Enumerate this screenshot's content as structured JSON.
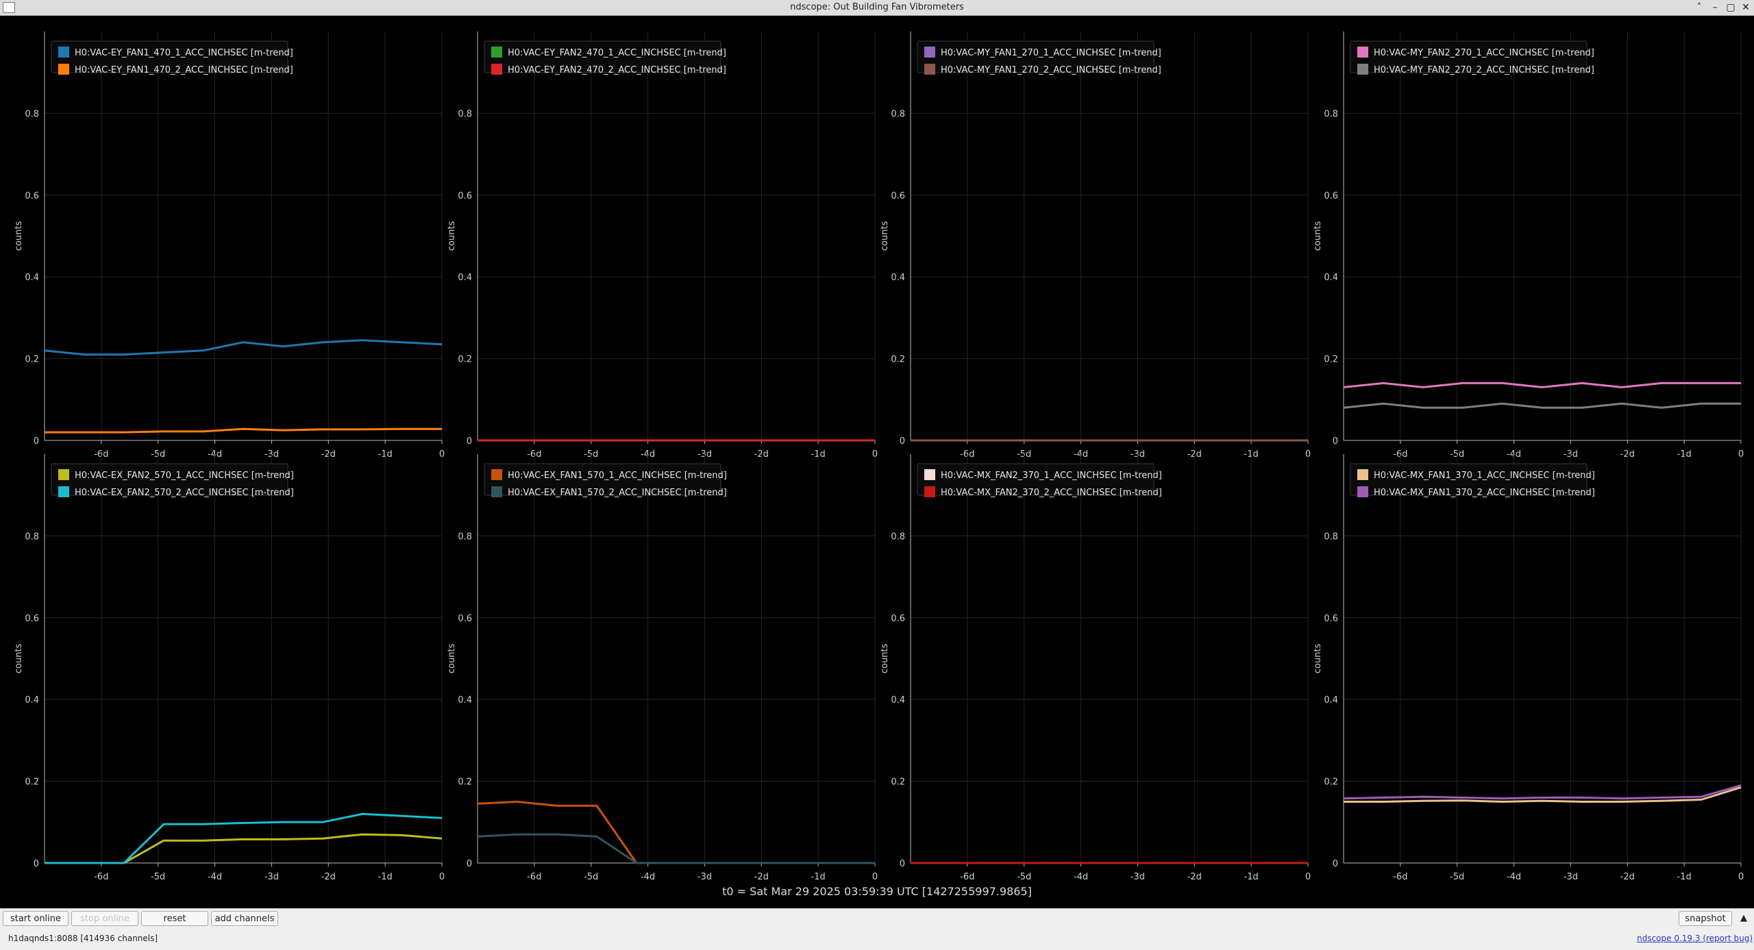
{
  "window": {
    "title": "ndscope: Out Building Fan Vibrometers",
    "buttons": [
      "˄",
      "–",
      "▢",
      "✕"
    ]
  },
  "axes": {
    "ylabel": "counts",
    "yticks": [
      "0",
      "0.2",
      "0.4",
      "0.6",
      "0.8"
    ],
    "xticks": [
      "-6d",
      "-5d",
      "-4d",
      "-3d",
      "-2d",
      "-1d",
      "0"
    ]
  },
  "chart_data": [
    {
      "type": "line",
      "series": [
        {
          "name": "H0:VAC-EY_FAN1_470_1_ACC_INCHSEC [m-trend]",
          "color": "#1f77b4",
          "y": [
            0.22,
            0.21,
            0.21,
            0.215,
            0.22,
            0.24,
            0.23,
            0.24,
            0.245,
            0.24,
            0.235
          ]
        },
        {
          "name": "H0:VAC-EY_FAN1_470_2_ACC_INCHSEC [m-trend]",
          "color": "#ff7f0e",
          "y": [
            0.02,
            0.02,
            0.02,
            0.022,
            0.022,
            0.028,
            0.025,
            0.027,
            0.027,
            0.028,
            0.028
          ]
        }
      ],
      "xlim": [
        -7,
        0
      ],
      "ylim": [
        0,
        1
      ],
      "xlabel": "",
      "ylabel": "counts",
      "grid": true,
      "legend": "top-left"
    },
    {
      "type": "line",
      "series": [
        {
          "name": "H0:VAC-EY_FAN2_470_1_ACC_INCHSEC [m-trend]",
          "color": "#2ca02c",
          "y": [
            0,
            0,
            0,
            0,
            0,
            0,
            0,
            0,
            0,
            0,
            0
          ]
        },
        {
          "name": "H0:VAC-EY_FAN2_470_2_ACC_INCHSEC [m-trend]",
          "color": "#d62728",
          "y": [
            0,
            0,
            0,
            0,
            0,
            0,
            0,
            0,
            0,
            0,
            0
          ]
        }
      ],
      "xlim": [
        -7,
        0
      ],
      "ylim": [
        0,
        1
      ],
      "xlabel": "",
      "ylabel": "counts",
      "grid": true,
      "legend": "top-left"
    },
    {
      "type": "line",
      "series": [
        {
          "name": "H0:VAC-MY_FAN1_270_1_ACC_INCHSEC [m-trend]",
          "color": "#9467bd",
          "y": [
            0,
            0,
            0,
            0,
            0,
            0,
            0,
            0,
            0,
            0,
            0
          ]
        },
        {
          "name": "H0:VAC-MY_FAN1_270_2_ACC_INCHSEC [m-trend]",
          "color": "#8c564b",
          "y": [
            0,
            0,
            0,
            0,
            0,
            0,
            0,
            0,
            0,
            0,
            0
          ]
        }
      ],
      "xlim": [
        -7,
        0
      ],
      "ylim": [
        0,
        1
      ],
      "xlabel": "",
      "ylabel": "counts",
      "grid": true,
      "legend": "top-left"
    },
    {
      "type": "line",
      "series": [
        {
          "name": "H0:VAC-MY_FAN2_270_1_ACC_INCHSEC [m-trend]",
          "color": "#e377c2",
          "y": [
            0.13,
            0.14,
            0.13,
            0.14,
            0.14,
            0.13,
            0.14,
            0.13,
            0.14,
            0.14,
            0.14
          ]
        },
        {
          "name": "H0:VAC-MY_FAN2_270_2_ACC_INCHSEC [m-trend]",
          "color": "#7f7f7f",
          "y": [
            0.08,
            0.09,
            0.08,
            0.08,
            0.09,
            0.08,
            0.08,
            0.09,
            0.08,
            0.09,
            0.09
          ]
        }
      ],
      "xlim": [
        -7,
        0
      ],
      "ylim": [
        0,
        1
      ],
      "xlabel": "",
      "ylabel": "counts",
      "grid": true,
      "legend": "top-left"
    },
    {
      "type": "line",
      "series": [
        {
          "name": "H0:VAC-EX_FAN2_570_1_ACC_INCHSEC [m-trend]",
          "color": "#bcbd22",
          "y": [
            0,
            0,
            0,
            0.055,
            0.055,
            0.058,
            0.058,
            0.06,
            0.07,
            0.068,
            0.06
          ]
        },
        {
          "name": "H0:VAC-EX_FAN2_570_2_ACC_INCHSEC [m-trend]",
          "color": "#17becf",
          "y": [
            0,
            0,
            0,
            0.095,
            0.095,
            0.098,
            0.1,
            0.1,
            0.12,
            0.115,
            0.11
          ]
        }
      ],
      "xlim": [
        -7,
        0
      ],
      "ylim": [
        0,
        1
      ],
      "xlabel": "",
      "ylabel": "counts",
      "grid": true,
      "legend": "top-left"
    },
    {
      "type": "line",
      "series": [
        {
          "name": "H0:VAC-EX_FAN1_570_1_ACC_INCHSEC [m-trend]",
          "color": "#c8510e",
          "y": [
            0.145,
            0.15,
            0.14,
            0.14,
            0,
            0,
            0,
            0,
            0,
            0,
            0
          ]
        },
        {
          "name": "H0:VAC-EX_FAN1_570_2_ACC_INCHSEC [m-trend]",
          "color": "#2f5560",
          "y": [
            0.065,
            0.07,
            0.07,
            0.065,
            0,
            0,
            0,
            0,
            0,
            0,
            0
          ]
        }
      ],
      "xlim": [
        -7,
        0
      ],
      "ylim": [
        0,
        1
      ],
      "xlabel": "",
      "ylabel": "counts",
      "grid": true,
      "legend": "top-left"
    },
    {
      "type": "line",
      "series": [
        {
          "name": "H0:VAC-MX_FAN2_370_1_ACC_INCHSEC [m-trend]",
          "color": "#f4dcd6",
          "y": [
            0,
            0,
            0,
            0,
            0,
            0,
            0,
            0,
            0,
            0,
            0
          ]
        },
        {
          "name": "H0:VAC-MX_FAN2_370_2_ACC_INCHSEC [m-trend]",
          "color": "#c81818",
          "y": [
            0,
            0,
            0,
            0,
            0,
            0,
            0,
            0,
            0,
            0,
            0
          ]
        }
      ],
      "xlim": [
        -7,
        0
      ],
      "ylim": [
        0,
        1
      ],
      "xlabel": "",
      "ylabel": "counts",
      "grid": true,
      "legend": "top-left"
    },
    {
      "type": "line",
      "series": [
        {
          "name": "H0:VAC-MX_FAN1_370_1_ACC_INCHSEC [m-trend]",
          "color": "#e9c28b",
          "y": [
            0.15,
            0.15,
            0.152,
            0.153,
            0.15,
            0.152,
            0.15,
            0.15,
            0.152,
            0.155,
            0.185
          ]
        },
        {
          "name": "H0:VAC-MX_FAN1_370_2_ACC_INCHSEC [m-trend]",
          "color": "#a05cb8",
          "y": [
            0.158,
            0.16,
            0.162,
            0.16,
            0.158,
            0.16,
            0.16,
            0.158,
            0.16,
            0.162,
            0.19
          ]
        }
      ],
      "xlim": [
        -7,
        0
      ],
      "ylim": [
        0,
        1
      ],
      "xlabel": "",
      "ylabel": "counts",
      "grid": true,
      "legend": "top-left"
    }
  ],
  "t0_label": "t0 = Sat Mar 29 2025 03:59:39 UTC [1427255997.9865]",
  "toolbar": {
    "start_online": "start online",
    "stop_online": "stop online",
    "reset": "reset",
    "add_channels": "add channels",
    "snapshot": "snapshot",
    "collapse": "▲"
  },
  "status": {
    "server": "h1daqnds1:8088  [414936 channels]",
    "version_link": "ndscope 0.19.3",
    "report_link": "(report bug)"
  }
}
